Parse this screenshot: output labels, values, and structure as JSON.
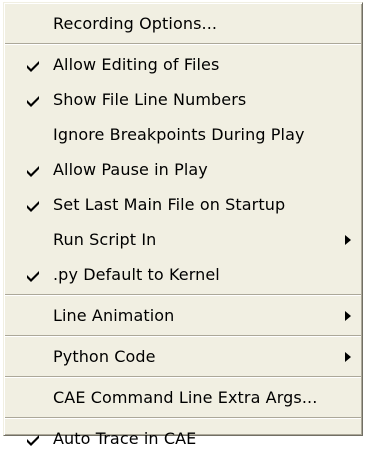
{
  "menu": {
    "items": [
      {
        "label": "Recording Options...",
        "checked": false,
        "submenu": false
      },
      {
        "separator": true
      },
      {
        "label": "Allow Editing of Files",
        "checked": true,
        "submenu": false
      },
      {
        "label": "Show File Line Numbers",
        "checked": true,
        "submenu": false
      },
      {
        "label": "Ignore Breakpoints During Play",
        "checked": false,
        "submenu": false
      },
      {
        "label": "Allow Pause in Play",
        "checked": true,
        "submenu": false
      },
      {
        "label": "Set Last Main File on Startup",
        "checked": true,
        "submenu": false
      },
      {
        "label": "Run Script In",
        "checked": false,
        "submenu": true
      },
      {
        "label": ".py Default to Kernel",
        "checked": true,
        "submenu": false
      },
      {
        "separator": true
      },
      {
        "label": "Line Animation",
        "checked": false,
        "submenu": true
      },
      {
        "separator": true
      },
      {
        "label": "Python Code",
        "checked": false,
        "submenu": true
      },
      {
        "separator": true
      },
      {
        "label": "CAE Command Line Extra Args...",
        "checked": false,
        "submenu": false
      },
      {
        "separator": true
      },
      {
        "label": "Auto Trace in CAE",
        "checked": true,
        "submenu": false
      }
    ],
    "icons": {
      "check": "checkmark-icon",
      "submenu": "submenu-arrow-icon"
    },
    "colors": {
      "background": "#f1efe2",
      "separator_dark": "#aca899",
      "separator_light": "#ffffff",
      "text": "#000000"
    }
  }
}
